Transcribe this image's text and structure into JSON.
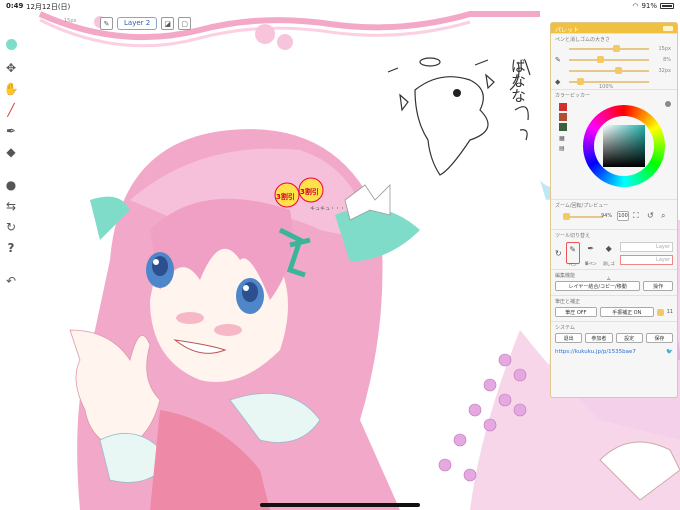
{
  "status": {
    "time": "0:49",
    "date": "12月12日(日)",
    "battery": "91%"
  },
  "layerbar": {
    "layer_label": "Layer 2",
    "small_label": "15px"
  },
  "canvas": {
    "sticker_text": "3割引",
    "sticker_text2": "3割引",
    "name_text": "キュキュ・・・",
    "handwriting": "ばなな"
  },
  "palette": {
    "title": "パレット",
    "brush_section": "ペンと消しゴムの大きさ",
    "brush_size": "15px",
    "opacity": "8%",
    "eraser_size": "32px",
    "eraser_opacity": "100%",
    "color_section": "カラーピッカー",
    "zoom_section": "ズーム/回転/プレビュー",
    "zoom_value": "94%",
    "zoom_reset": "100",
    "tool_section": "ツール切り替え",
    "tool_labels": [
      "ペン",
      "筆ペン",
      "消しゴム"
    ],
    "layer_slot_1": "Layer",
    "layer_slot_2": "Layer",
    "edit_section": "編集機能",
    "edit_button": "レイヤー結合/コピー/移動",
    "op_button": "操作",
    "correction_section": "筆圧と補正",
    "pressure_button": "筆圧 OFF",
    "handcorr_button": "手振補正 ON",
    "handcorr_value": "11",
    "system_section": "システム",
    "system_buttons": [
      "退出",
      "参加者",
      "設定",
      "保存"
    ],
    "url": "https://kukuku.jp/p/1535bae7"
  },
  "colors": {
    "accent": "#f0c040",
    "link": "#2a6fd8",
    "pink": "#f2a9c9",
    "teal": "#7fdcc8"
  }
}
